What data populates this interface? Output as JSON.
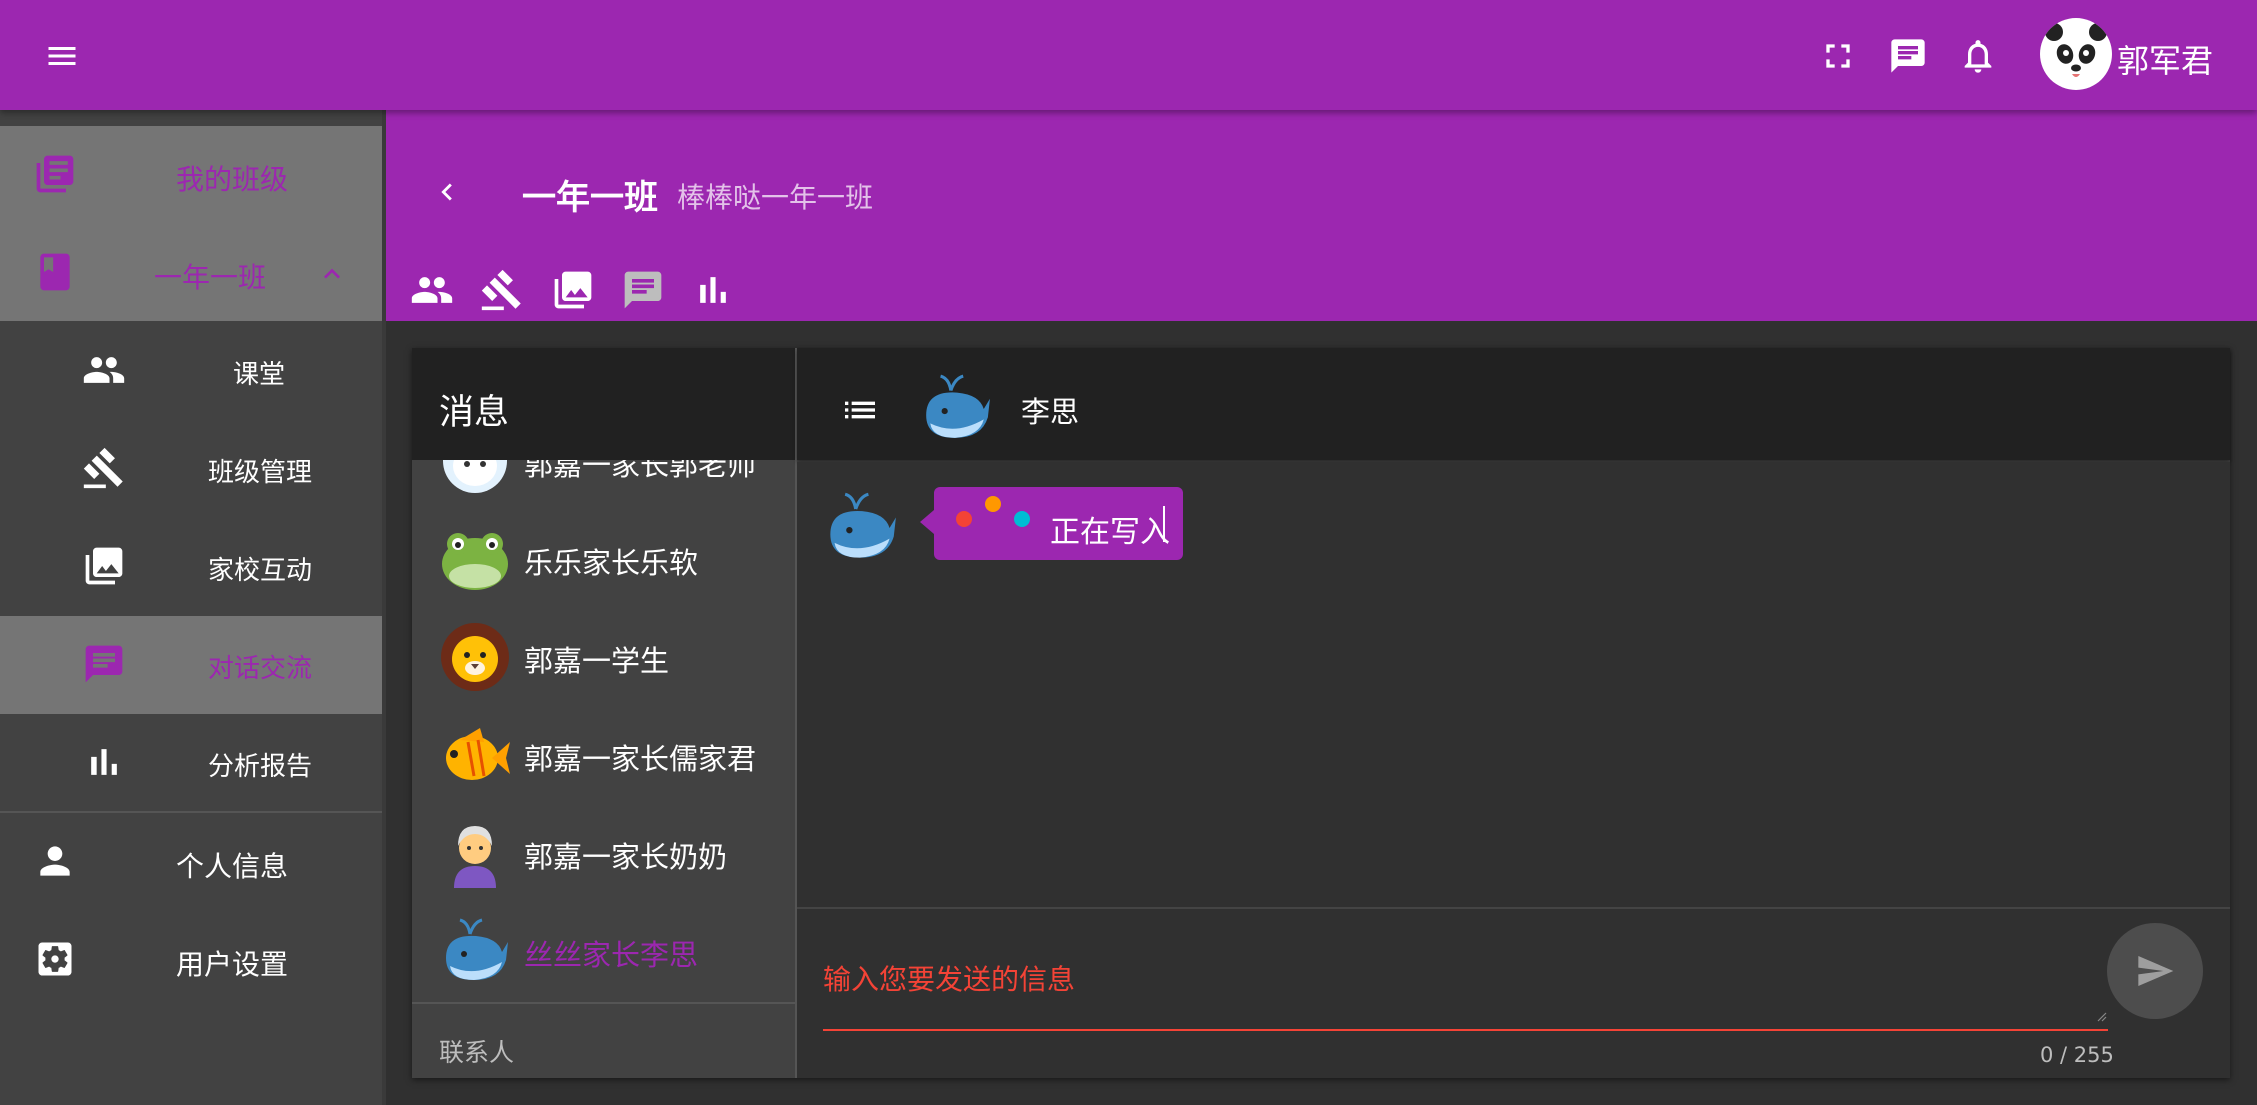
{
  "topbar": {
    "menu_icon": "menu-icon",
    "icons": [
      "fullscreen-icon",
      "chat-icon",
      "bell-icon"
    ],
    "user_name": "郭军君",
    "avatar_icon": "panda-avatar"
  },
  "sidebar": {
    "my_classes": "我的班级",
    "class_group": "一年一班",
    "sub_items": [
      {
        "label": "课堂",
        "icon": "people-icon"
      },
      {
        "label": "班级管理",
        "icon": "gavel-icon"
      },
      {
        "label": "家校互动",
        "icon": "photo-library-icon"
      },
      {
        "label": "对话交流",
        "icon": "message-icon"
      },
      {
        "label": "分析报告",
        "icon": "bar-chart-icon"
      }
    ],
    "profile": "个人信息",
    "settings": "用户设置"
  },
  "class_header": {
    "title": "一年一班",
    "subtitle": "棒棒哒一年一班",
    "tabs": [
      "people-icon",
      "gavel-icon",
      "photo-library-icon",
      "message-icon",
      "bar-chart-icon"
    ]
  },
  "messages_panel": {
    "title": "消息",
    "contacts": [
      {
        "name": "郭嘉一家长郭老师",
        "avatar": "unicorn-avatar"
      },
      {
        "name": "乐乐家长乐软",
        "avatar": "frog-avatar"
      },
      {
        "name": "郭嘉一学生",
        "avatar": "lion-avatar"
      },
      {
        "name": "郭嘉一家长儒家君",
        "avatar": "fish-avatar"
      },
      {
        "name": "郭嘉一家长奶奶",
        "avatar": "grandma-avatar"
      },
      {
        "name": "丝丝家长李思",
        "avatar": "whale-avatar",
        "active": true
      }
    ],
    "contacts_label": "联系人"
  },
  "chat": {
    "contact_name": "李思",
    "typing_text": "正在写入",
    "typing_dot_colors": [
      "#f44336",
      "#ff9800",
      "#00bcd4"
    ],
    "input_placeholder": "输入您要发送的信息",
    "counter": "0 / 255"
  },
  "colors": {
    "primary": "#9c27b0",
    "background": "#303030",
    "surface": "#424242",
    "error": "#f44336"
  }
}
